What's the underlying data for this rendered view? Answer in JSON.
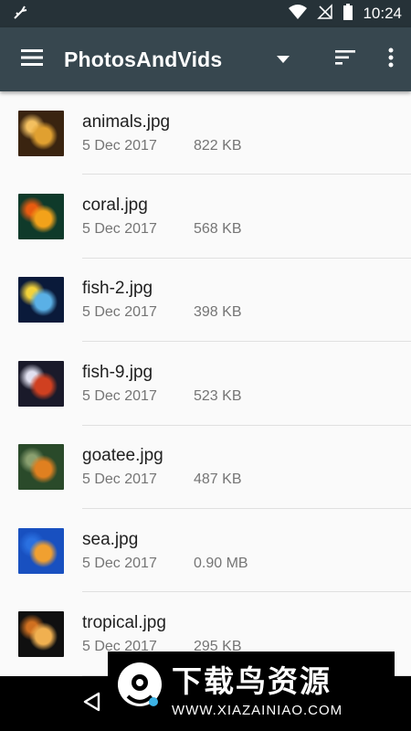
{
  "status_bar": {
    "time": "10:24",
    "icons": [
      "usb-debug-icon",
      "wifi-icon",
      "no-signal-icon",
      "battery-icon"
    ]
  },
  "app_bar": {
    "title": "PhotosAndVids",
    "icons": [
      "menu-icon",
      "dropdown-arrow-icon",
      "sort-icon",
      "more-vert-icon"
    ],
    "background": "#37474f"
  },
  "files": [
    {
      "name": "animals.jpg",
      "date": "5 Dec 2017",
      "size": "822 KB",
      "thumb": [
        "#3a2410",
        "#e0a030",
        "#f3c060"
      ]
    },
    {
      "name": "coral.jpg",
      "date": "5 Dec 2017",
      "size": "568 KB",
      "thumb": [
        "#0f3a2a",
        "#f3a21a",
        "#e85b10"
      ]
    },
    {
      "name": "fish-2.jpg",
      "date": "5 Dec 2017",
      "size": "398 KB",
      "thumb": [
        "#0a1a3a",
        "#5ab0e6",
        "#f2d23a"
      ]
    },
    {
      "name": "fish-9.jpg",
      "date": "5 Dec 2017",
      "size": "523 KB",
      "thumb": [
        "#1a1a2a",
        "#d04020",
        "#e0e0f0"
      ]
    },
    {
      "name": "goatee.jpg",
      "date": "5 Dec 2017",
      "size": "487 KB",
      "thumb": [
        "#2a4a2a",
        "#e08020",
        "#8aa070"
      ]
    },
    {
      "name": "sea.jpg",
      "date": "5 Dec 2017",
      "size": "0.90 MB",
      "thumb": [
        "#1850c0",
        "#f0a030",
        "#2a70e0"
      ]
    },
    {
      "name": "tropical.jpg",
      "date": "5 Dec 2017",
      "size": "295 KB",
      "thumb": [
        "#101010",
        "#f0b050",
        "#d07020"
      ]
    }
  ],
  "watermark": {
    "title": "下载鸟资源",
    "url": "WWW.XIAZAINIAO.COM"
  }
}
